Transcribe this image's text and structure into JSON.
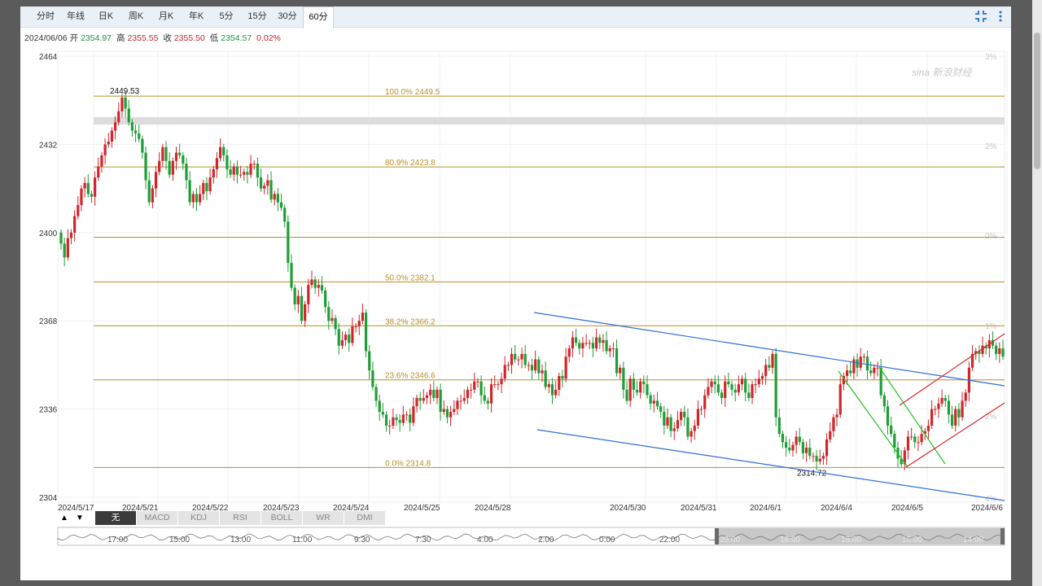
{
  "tabs": [
    {
      "label": "分时",
      "active": false
    },
    {
      "label": "年线",
      "active": false
    },
    {
      "label": "日K",
      "active": false
    },
    {
      "label": "周K",
      "active": false
    },
    {
      "label": "月K",
      "active": false
    },
    {
      "label": "年K",
      "active": false
    },
    {
      "label": "5分",
      "active": false
    },
    {
      "label": "15分",
      "active": false
    },
    {
      "label": "30分",
      "active": false
    },
    {
      "label": "60分",
      "active": true
    }
  ],
  "quote": {
    "date": "2024/06/06",
    "open_label": "开",
    "open": "2354.97",
    "high_label": "高",
    "high": "2355.55",
    "close_label": "收",
    "close": "2355.50",
    "low_label": "低",
    "low": "2354.57",
    "change": "0.02%"
  },
  "indicators": [
    "无",
    "MACD",
    "KDJ",
    "RSI",
    "BOLL",
    "WR",
    "DMI"
  ],
  "indicator_active": "无",
  "nav_arrows": [
    "▲",
    "▼"
  ],
  "colors": {
    "up": "#d0262a",
    "down": "#1e9e36",
    "fib": "#b8902a",
    "channel_blue": "#2f6fd6",
    "channel_green": "#22c322",
    "channel_red": "#d8262a"
  },
  "watermark": "sina 新浪财经",
  "navigator_labels": [
    "17:00",
    "15:00",
    "13:00",
    "11:00",
    "9:30",
    "7:30",
    "4:00",
    "2:00",
    "0:00",
    "22:00",
    "20:00",
    "18:00",
    "18:00",
    "16:00",
    "14:00"
  ],
  "chart_data": {
    "type": "candlestick",
    "ylim": [
      2304,
      2464
    ],
    "y_ticks": [
      "2464",
      "2432",
      "2400",
      "2368",
      "2336",
      "2304"
    ],
    "percent_ticks": [
      "3%",
      "2%",
      "0%",
      "1%",
      "2%",
      "4%"
    ],
    "x_labels": [
      "2024/5/17",
      "2024/5/21",
      "2024/5/22",
      "2024/5/23",
      "2024/5/24",
      "2024/5/25",
      "2024/5/28",
      "2024/5/30",
      "2024/5/31",
      "2024/6/1",
      "2024/6/4",
      "2024/6/5",
      "2024/6/6"
    ],
    "fib_levels": [
      {
        "label": "100.0% 2449.5",
        "value": 2449.5
      },
      {
        "label": "80.9% 2423.8",
        "value": 2423.8
      },
      {
        "label": "",
        "value": 2398.3
      },
      {
        "label": "50.0% 2382.1",
        "value": 2382.1
      },
      {
        "label": "38.2% 2366.2",
        "value": 2366.2
      },
      {
        "label": "23.6% 2346.6",
        "value": 2346.6
      },
      {
        "label": "0.0% 2314.8",
        "value": 2314.8
      }
    ],
    "annotations": [
      {
        "text": "2449.53",
        "value": 2449.53
      },
      {
        "text": "2314.72",
        "value": 2314.72
      }
    ],
    "closes": [
      2396,
      2391,
      2398,
      2400,
      2406,
      2410,
      2416,
      2418,
      2414,
      2413,
      2420,
      2424,
      2428,
      2432,
      2433,
      2437,
      2440,
      2444,
      2449,
      2445,
      2440,
      2437,
      2436,
      2434,
      2429,
      2419,
      2411,
      2416,
      2422,
      2426,
      2431,
      2426,
      2421,
      2426,
      2429,
      2428,
      2425,
      2419,
      2411,
      2414,
      2411,
      2414,
      2418,
      2415,
      2420,
      2423,
      2427,
      2431,
      2428,
      2423,
      2421,
      2424,
      2421,
      2421,
      2422,
      2421,
      2425,
      2425,
      2420,
      2416,
      2417,
      2419,
      2412,
      2414,
      2411,
      2409,
      2404,
      2389,
      2380,
      2374,
      2377,
      2368,
      2374,
      2381,
      2383,
      2380,
      2381,
      2379,
      2373,
      2368,
      2369,
      2365,
      2359,
      2361,
      2363,
      2360,
      2366,
      2366,
      2368,
      2371,
      2357,
      2350,
      2344,
      2339,
      2335,
      2334,
      2330,
      2330,
      2333,
      2332,
      2331,
      2334,
      2334,
      2331,
      2337,
      2340,
      2339,
      2340,
      2341,
      2343,
      2340,
      2343,
      2335,
      2336,
      2333,
      2335,
      2336,
      2339,
      2339,
      2340,
      2343,
      2343,
      2346,
      2346,
      2341,
      2339,
      2338,
      2345,
      2345,
      2345,
      2347,
      2352,
      2352,
      2356,
      2354,
      2354,
      2356,
      2352,
      2352,
      2350,
      2354,
      2349,
      2350,
      2344,
      2345,
      2341,
      2343,
      2348,
      2347,
      2355,
      2358,
      2362,
      2360,
      2358,
      2360,
      2360,
      2360,
      2358,
      2362,
      2360,
      2361,
      2357,
      2358,
      2358,
      2349,
      2351,
      2343,
      2339,
      2347,
      2343,
      2342,
      2346,
      2345,
      2341,
      2338,
      2339,
      2337,
      2335,
      2330,
      2333,
      2328,
      2329,
      2332,
      2335,
      2333,
      2326,
      2328,
      2330,
      2336,
      2336,
      2341,
      2344,
      2346,
      2345,
      2342,
      2340,
      2346,
      2345,
      2343,
      2342,
      2345,
      2347,
      2342,
      2340,
      2345,
      2345,
      2347,
      2348,
      2352,
      2351,
      2356,
      2333,
      2327,
      2324,
      2322,
      2321,
      2323,
      2326,
      2324,
      2320,
      2322,
      2319,
      2319,
      2317,
      2318,
      2319,
      2325,
      2328,
      2333,
      2334,
      2345,
      2348,
      2350,
      2349,
      2354,
      2351,
      2355,
      2355,
      2350,
      2349,
      2351,
      2351,
      2341,
      2337,
      2330,
      2327,
      2322,
      2318,
      2316,
      2321,
      2326,
      2326,
      2324,
      2324,
      2327,
      2328,
      2330,
      2336,
      2336,
      2338,
      2340,
      2339,
      2334,
      2330,
      2336,
      2333,
      2339,
      2342,
      2351,
      2356,
      2357,
      2356,
      2359,
      2358,
      2361,
      2359,
      2356,
      2358,
      2355
    ]
  }
}
